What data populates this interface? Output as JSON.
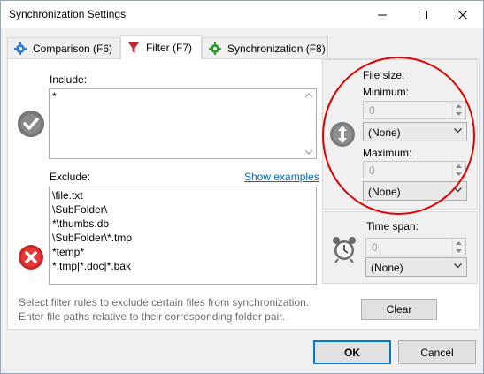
{
  "window": {
    "title": "Synchronization Settings"
  },
  "tabs": [
    {
      "label": "Comparison (F6)",
      "icon": "gear-blue-icon"
    },
    {
      "label": "Filter (F7)",
      "icon": "funnel-icon"
    },
    {
      "label": "Synchronization (F8)",
      "icon": "gear-green-icon"
    }
  ],
  "filter": {
    "include_label": "Include:",
    "include_lines": [
      "*"
    ],
    "exclude_label": "Exclude:",
    "show_examples": "Show examples",
    "exclude_lines": [
      "\\file.txt",
      "\\SubFolder\\",
      "*\\thumbs.db",
      "\\SubFolder\\*.tmp",
      "*temp*",
      "*.tmp|*.doc|*.bak"
    ],
    "hint_line1": "Select filter rules to exclude certain files from synchronization.",
    "hint_line2": "Enter file paths relative to their corresponding folder pair."
  },
  "file_size": {
    "label": "File size:",
    "minimum_label": "Minimum:",
    "minimum_value": "0",
    "minimum_unit": "(None)",
    "maximum_label": "Maximum:",
    "maximum_value": "0",
    "maximum_unit": "(None)"
  },
  "time_span": {
    "label": "Time span:",
    "value": "0",
    "unit": "(None)"
  },
  "buttons": {
    "clear": "Clear",
    "ok": "OK",
    "cancel": "Cancel"
  },
  "colors": {
    "accent": "#0078d7",
    "link": "#0066cc",
    "highlight_circle": "#e00000"
  }
}
